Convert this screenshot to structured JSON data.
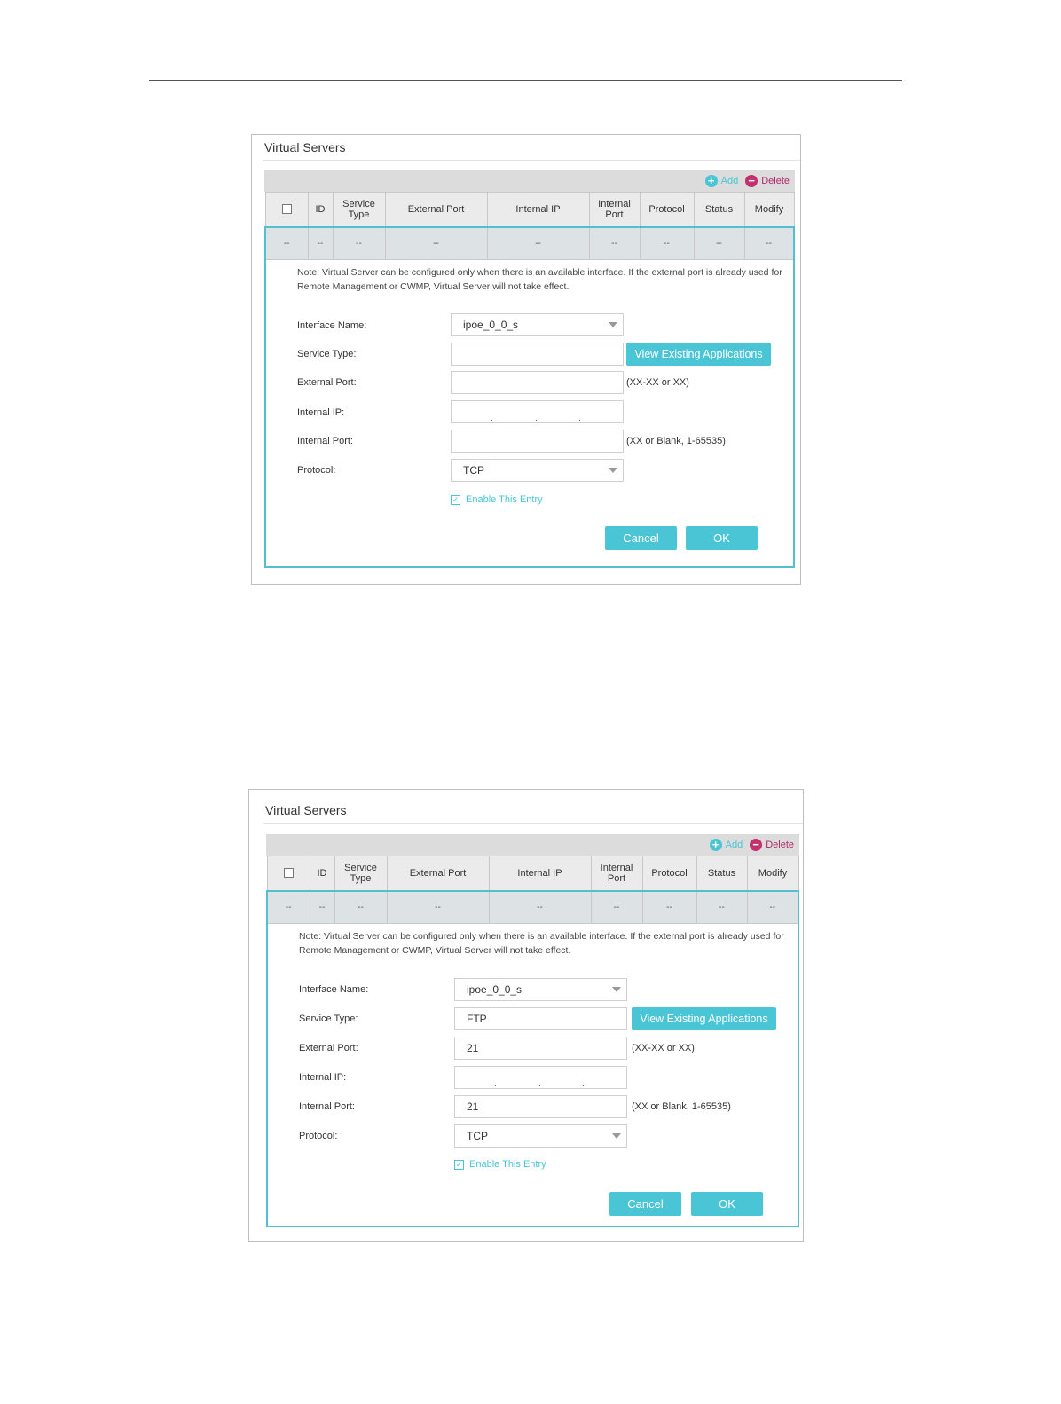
{
  "panels": [
    {
      "title": "Virtual Servers",
      "toolbar": {
        "add_label": "Add",
        "delete_label": "Delete",
        "add_icon": "plus-circle-icon",
        "delete_icon": "minus-circle-icon"
      },
      "columns": [
        "ID",
        "Service Type",
        "External Port",
        "Internal IP",
        "Internal Port",
        "Protocol",
        "Status",
        "Modify"
      ],
      "row": [
        "--",
        "--",
        "--",
        "--",
        "--",
        "--",
        "--",
        "--",
        "--"
      ],
      "note": "Note: Virtual Server can be configured only when there is an available interface. If the external port is already used for Remote Management or CWMP, Virtual Server will not take effect.",
      "form": {
        "interface_label": "Interface Name:",
        "interface_value": "ipoe_0_0_s",
        "service_type_label": "Service Type:",
        "service_type_value": "",
        "view_apps_label": "View Existing Applications",
        "external_port_label": "External Port:",
        "external_port_value": "",
        "external_port_hint": "(XX-XX or XX)",
        "internal_ip_label": "Internal IP:",
        "internal_port_label": "Internal Port:",
        "internal_port_value": "",
        "internal_port_hint": "(XX or Blank, 1-65535)",
        "protocol_label": "Protocol:",
        "protocol_value": "TCP",
        "enable_label": "Enable This Entry",
        "enable_checked": true,
        "cancel_label": "Cancel",
        "ok_label": "OK"
      }
    },
    {
      "title": "Virtual Servers",
      "toolbar": {
        "add_label": "Add",
        "delete_label": "Delete",
        "add_icon": "plus-circle-icon",
        "delete_icon": "minus-circle-icon"
      },
      "columns": [
        "ID",
        "Service Type",
        "External Port",
        "Internal IP",
        "Internal Port",
        "Protocol",
        "Status",
        "Modify"
      ],
      "row": [
        "--",
        "--",
        "--",
        "--",
        "--",
        "--",
        "--",
        "--",
        "--"
      ],
      "note": "Note: Virtual Server can be configured only when there is an available interface. If the external port is already used for Remote Management or CWMP, Virtual Server will not take effect.",
      "form": {
        "interface_label": "Interface Name:",
        "interface_value": "ipoe_0_0_s",
        "service_type_label": "Service Type:",
        "service_type_value": "FTP",
        "view_apps_label": "View Existing Applications",
        "external_port_label": "External Port:",
        "external_port_value": "21",
        "external_port_hint": "(XX-XX or XX)",
        "internal_ip_label": "Internal IP:",
        "internal_port_label": "Internal Port:",
        "internal_port_value": "21",
        "internal_port_hint": "(XX or Blank, 1-65535)",
        "protocol_label": "Protocol:",
        "protocol_value": "TCP",
        "enable_label": "Enable This Entry",
        "enable_checked": true,
        "cancel_label": "Cancel",
        "ok_label": "OK"
      }
    }
  ],
  "colors": {
    "accent": "#4ac5d6",
    "delete": "#c4306f",
    "border_accent": "#54bfce"
  }
}
